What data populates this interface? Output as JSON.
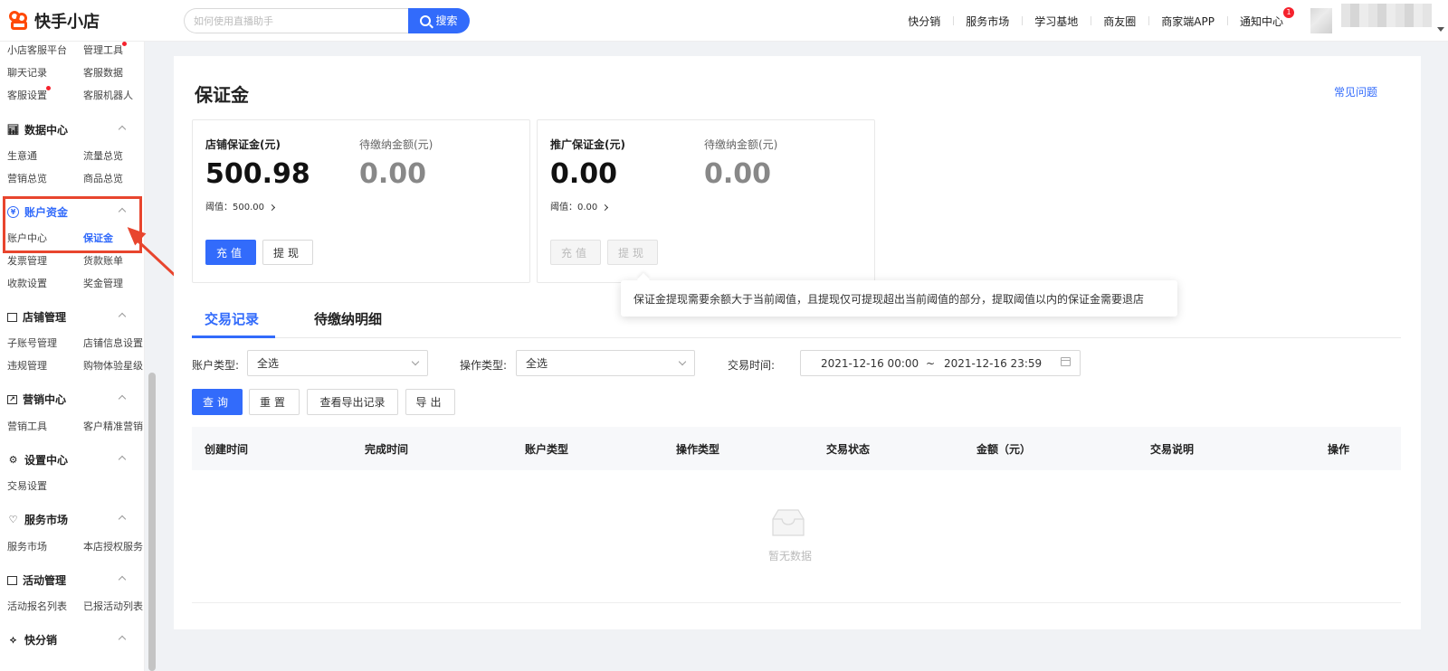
{
  "header": {
    "logo_text": "快手小店",
    "search_placeholder": "如何使用直播助手",
    "search_button": "搜索",
    "nav": [
      "快分销",
      "服务市场",
      "学习基地",
      "商友圈",
      "商家端APP",
      "通知中心"
    ],
    "notification_count": "1"
  },
  "sidebar": {
    "top_links": [
      "小店客服平台",
      "管理工具",
      "聊天记录",
      "客服数据",
      "客服设置",
      "客服机器人"
    ],
    "groups": [
      {
        "title": "数据中心",
        "icon": "bar-chart-icon",
        "links": [
          "生意通",
          "流量总览",
          "营销总览",
          "商品总览"
        ]
      },
      {
        "title": "账户资金",
        "icon": "yuan-circle-icon",
        "links": [
          "账户中心",
          "保证金",
          "发票管理",
          "货款账单",
          "收款设置",
          "奖金管理"
        ]
      },
      {
        "title": "店铺管理",
        "icon": "store-icon",
        "links": [
          "子账号管理",
          "店铺信息设置",
          "违规管理",
          "购物体验星级"
        ]
      },
      {
        "title": "营销中心",
        "icon": "trend-icon",
        "links": [
          "营销工具",
          "客户精准营销"
        ]
      },
      {
        "title": "设置中心",
        "icon": "gear-icon",
        "links": [
          "交易设置"
        ]
      },
      {
        "title": "服务市场",
        "icon": "heart-icon",
        "links": [
          "服务市场",
          "本店授权服务"
        ]
      },
      {
        "title": "活动管理",
        "icon": "gift-icon",
        "links": [
          "活动报名列表",
          "已报活动列表"
        ]
      },
      {
        "title": "快分销",
        "icon": "share-icon",
        "links": []
      }
    ],
    "accent_color": "#326bfb"
  },
  "page": {
    "title": "保证金",
    "faq_link": "常见问题",
    "store_card": {
      "label": "店铺保证金(元)",
      "amount": "500.98",
      "pending_label": "待缴纳金额(元)",
      "pending_amount": "0.00",
      "threshold": "阈值：500.00",
      "recharge_button": "充值",
      "withdraw_button": "提现"
    },
    "promo_card": {
      "label": "推广保证金(元)",
      "amount": "0.00",
      "pending_label": "待缴纳金额(元)",
      "pending_amount": "0.00",
      "threshold": "阈值：0.00",
      "recharge_button": "充值",
      "withdraw_button": "提现"
    },
    "tooltip": "保证金提现需要余额大于当前阈值，且提现仅可提现超出当前阈值的部分，提取阈值以内的保证金需要退店",
    "tabs": [
      "交易记录",
      "待缴纳明细"
    ],
    "filters": {
      "account_type_label": "账户类型:",
      "account_type_value": "全选",
      "op_type_label": "操作类型:",
      "op_type_value": "全选",
      "time_label": "交易时间:",
      "time_start": "2021-12-16 00:00",
      "time_sep": "~",
      "time_end": "2021-12-16 23:59"
    },
    "actions": [
      "查询",
      "重置",
      "查看导出记录",
      "导出"
    ],
    "table_headers": [
      "创建时间",
      "完成时间",
      "账户类型",
      "操作类型",
      "交易状态",
      "金额（元）",
      "交易说明",
      "操作"
    ],
    "empty_text": "暂无数据"
  }
}
